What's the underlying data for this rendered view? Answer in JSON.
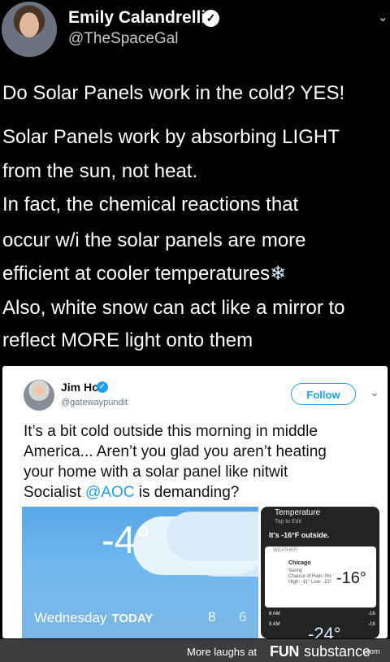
{
  "header": {
    "name": "Emily Calandrelli",
    "handle": "@TheSpaceGal",
    "verified_glyph": "✓",
    "chevron_glyph": "⌄"
  },
  "tweet": {
    "lines": [
      "Do Solar Panels work in the cold? YES!",
      "Solar Panels work by absorbing LIGHT",
      "from the sun, not heat.",
      "In fact, the chemical reactions that",
      "occur w/i the solar panels are more",
      "efficient at cooler temperatures",
      "Also, white snow can act like a mirror to",
      "reflect MORE light onto them"
    ],
    "snowflake": "❄"
  },
  "quoted": {
    "name": "Jim Hoft",
    "handle": "@gatewaypundit",
    "follow_label": "Follow",
    "chevron_glyph": "⌄",
    "text_lines": [
      "It’s a bit cold outside this morning in middle",
      "America... Aren’t you glad you aren’t heating",
      "your home with a solar panel like nitwit",
      "Socialist "
    ],
    "mention": "@AOC",
    "after_mention": " is demanding?"
  },
  "weather_widget": {
    "temperature": "-4°",
    "day": "Wednesday",
    "today": "TODAY",
    "high": "8",
    "low": "6"
  },
  "phone_panel": {
    "title": "Temperature",
    "tap": "Tap to Edit",
    "outside": "It's -16°F outside.",
    "weather_label": "WEATHER",
    "city": "Chicago",
    "condition": "Sunny",
    "rain": "Chance of Rain: 0%",
    "range": "High: -11° Low: -22°",
    "temp": "-16°",
    "rows": [
      {
        "time": "8 AM",
        "temp": "-16"
      },
      {
        "time": "9 AM",
        "temp": "-16"
      }
    ],
    "bottom_temp": "-24°"
  },
  "footer": {
    "more": "More laughs at",
    "brand": "FUNsubstance",
    "brand_bold": "FUN",
    "brand_rest": "substance",
    "domain": ".com"
  }
}
